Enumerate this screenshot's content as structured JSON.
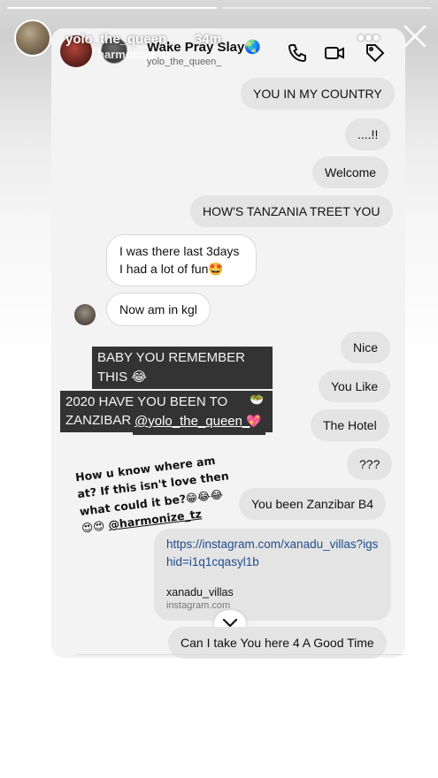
{
  "story": {
    "username": "yolo_the_queen_",
    "time_ago": "34m",
    "progress_segments": 2,
    "more_icon": "more-icon",
    "close_icon": "close-icon"
  },
  "chat": {
    "header": {
      "title": "Wake Pray Slay🌏",
      "subtitle": "yolo_the_queen_",
      "overlay_name": "harmonize_tz",
      "icons": [
        "phone-icon",
        "video-icon",
        "tag-icon"
      ]
    },
    "messages": [
      {
        "side": "out",
        "text": "YOU IN MY COUNTRY"
      },
      {
        "side": "out",
        "text": "....!!"
      },
      {
        "side": "out",
        "text": "Welcome"
      },
      {
        "side": "out",
        "text": "HOW'S TANZANIA TREET YOU"
      },
      {
        "side": "in",
        "lines": [
          "I was there last 3days",
          "I had a lot of fun🤩"
        ]
      },
      {
        "side": "in",
        "text": "Now am in kgl"
      },
      {
        "side": "out",
        "text": "Nice"
      },
      {
        "side": "out",
        "text": "You Like"
      },
      {
        "side": "out",
        "text": "The Hotel"
      },
      {
        "side": "out",
        "text": "???"
      },
      {
        "side": "out",
        "text": "You been Zanzibar B4"
      },
      {
        "side": "out",
        "text": "Can I take You here 4 A Good Time"
      }
    ],
    "shared_post": {
      "line1": "BABY YOU REMEMBER THIS 😂",
      "line2": "2020 HAVE YOU BEEN TO ZANZIBAR",
      "emoji": "🥗",
      "handle": "@yolo_the_queen_",
      "handle_emoji": "💖"
    },
    "story_caption": {
      "line1": "How u know where am",
      "line2": "at? If this isn't love then",
      "line3": "what could it be?😁😂😂",
      "line4_emoji": "😍😍",
      "line4_handle": "@harmonize_tz"
    },
    "link_card": {
      "url": "https://instagram.com/xanadu_villas?igshid=i1q1cqasyl1b",
      "title": "xanadu_villas",
      "domain": "instagram.com"
    }
  }
}
